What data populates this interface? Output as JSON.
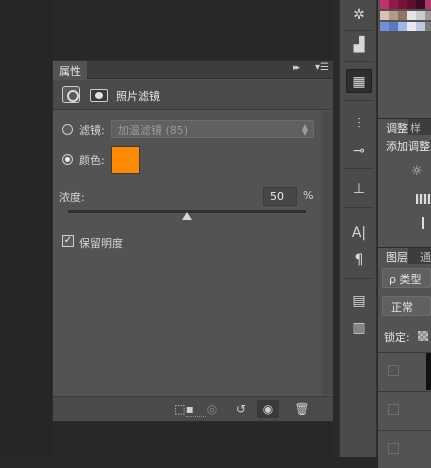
{
  "properties_panel": {
    "tab_label": "属性",
    "collapse_glyph": "▸▸",
    "menu_glyph": "▾☰",
    "header_title": "照片滤镜",
    "filter_label": "滤镜:",
    "filter_value": "加温滤镜 (85)",
    "filter_selected": false,
    "color_label": "颜色:",
    "color_selected": true,
    "color_value": "#ff8a00",
    "density_label": "浓度:",
    "density_value": "50",
    "density_percent_sign": "%",
    "density_fraction": 0.5,
    "preserve_label": "保留明度",
    "preserve_checked": true,
    "footer_icons": [
      "clip-to-layer-icon",
      "view-previous-icon",
      "reset-icon",
      "visibility-icon",
      "delete-icon"
    ]
  },
  "tool_strip": {
    "icons": [
      "compass-icon",
      "histogram-icon",
      "info-icon",
      "brush-presets-icon",
      "brush-icon",
      "clone-source-icon",
      "character-icon",
      "paragraph-icon",
      "notes-icon",
      "document-icon"
    ],
    "character_glyph": "A|",
    "paragraph_glyph": "¶"
  },
  "adjustments_panel": {
    "tab_label": "调整",
    "styles_tab_label": "样",
    "add_adjustment_label": "添加调整"
  },
  "layers_panel": {
    "tab_label": "图层",
    "channels_tab_label": "通",
    "kind_label": "ρ 类型",
    "blend_mode": "正常",
    "lock_label": "锁定:"
  },
  "colors": {
    "panel_bg": "#535353",
    "swatch_orange": "#ff8a00"
  }
}
